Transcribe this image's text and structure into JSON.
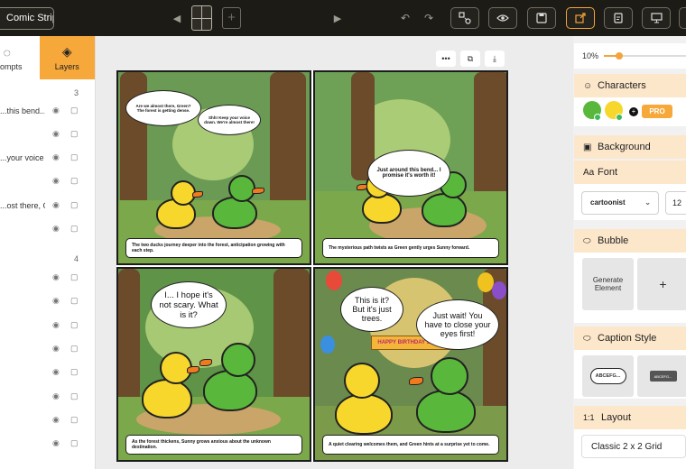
{
  "topbar": {
    "project_title": "Comic Strips",
    "prev_icon": "triangle-left-icon",
    "next_icon": "triangle-right-icon",
    "add_panel_label": "+"
  },
  "left_sidebar": {
    "tabs": [
      {
        "label": "Prompts",
        "icon": "lightbulb-icon",
        "active": false
      },
      {
        "label": "Layers",
        "icon": "layers-icon",
        "active": true
      }
    ],
    "groups": [
      {
        "number": "3",
        "rows": [
          "...this bend......",
          "",
          "...your voice do...",
          "",
          "...ost there, Gr...",
          ""
        ]
      },
      {
        "number": "4",
        "rows": [
          "",
          "",
          "",
          "",
          "",
          "",
          "",
          ""
        ]
      }
    ]
  },
  "canvas": {
    "tools": [
      {
        "name": "more",
        "glyph": "•••"
      },
      {
        "name": "copy",
        "glyph": "⧉"
      },
      {
        "name": "download",
        "glyph": "⤓"
      }
    ],
    "panels": [
      {
        "bubbles": [
          "Are we almost there, Green? The forest is getting dense.",
          "Shh! Keep your voice down. We're almost there!"
        ],
        "caption": "The two ducks journey deeper into the forest, anticipation growing with each step."
      },
      {
        "bubbles": [
          "Just around this bend... I promise it's worth it!"
        ],
        "caption": "The mysterious path twists as Green gently urges Sunny forward."
      },
      {
        "bubbles": [
          "I... I hope it's not scary. What is it?"
        ],
        "caption": "As the forest thickens, Sunny grows anxious about the unknown destination."
      },
      {
        "bubbles": [
          "This is it? But it's just trees.",
          "Just wait! You have to close your eyes first!"
        ],
        "banner": "HAPPY BIRTHDAY SUNNY!",
        "caption": "A quiet clearing welcomes them, and Green hints at a surprise yet to come."
      }
    ]
  },
  "right_panel": {
    "zoom_label": "10%",
    "zoom_value": 0.1,
    "characters_title": "Characters",
    "pro_label": "PRO",
    "background_title": "Background",
    "font_title": "Font",
    "font_value": "cartoonist",
    "font_size": "12",
    "bubble_title": "Bubble",
    "generate_label": "Generate Element",
    "add_label": "+",
    "caption_title": "Caption Style",
    "caption_sample_1": "ABCEFG...",
    "caption_sample_2": "ABCEFG...",
    "layout_title": "Layout",
    "layout_icon_label": "1:1",
    "layout_value": "Classic 2 x 2 Grid"
  },
  "colors": {
    "topbar": "#1d1b16",
    "accent": "#f6a83b",
    "section_header": "#fde7cb"
  }
}
